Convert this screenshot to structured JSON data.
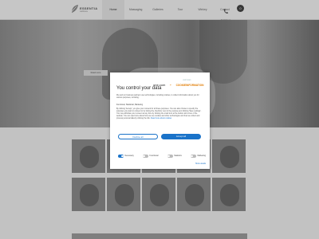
{
  "header": {
    "logo_text": "ESSENTIA",
    "logo_sub": "wellness",
    "nav": [
      "Home",
      "Massaging",
      "Galleries",
      "Tour",
      "Winkey",
      "Contact"
    ],
    "phone_label": "Kontakt os",
    "cart_count": "0"
  },
  "hero": {
    "button_label": "Read more"
  },
  "modal": {
    "brand": "one.com",
    "brand_sep": "+",
    "brand_ci": "COOKIEINFORMATION",
    "brand_ci_sub": "CERTIFIED",
    "title": "You control your data",
    "intro": "We and our business partners use technologies, including cookies, to collect information about you for various purposes, including:",
    "purposes": "Functional, Statistical, Marketing",
    "more": "By clicking 'Accept', you give your consent for all these purposes. You can also choose to specify the purposes you want to consent to by ticking the checkbox next to the purpose and clicking 'Save settings'. You may withdraw your consent at any time by clicking the small icon at the bottom left corner of the website. You can read more about how we use cookies and other technologies and how we collect and process personal data by clicking the link.",
    "more_link": "Read more about cookies",
    "deny_label": "Decline all",
    "accept_label": "Accept all",
    "toggles": [
      {
        "label": "Necessary",
        "on": true
      },
      {
        "label": "Functional",
        "on": false
      },
      {
        "label": "Statistics",
        "on": false
      },
      {
        "label": "Marketing",
        "on": false
      }
    ],
    "show_details": "Show details"
  },
  "colors": {
    "accent": "#1a73c9",
    "brand_orange": "#e07b00"
  }
}
